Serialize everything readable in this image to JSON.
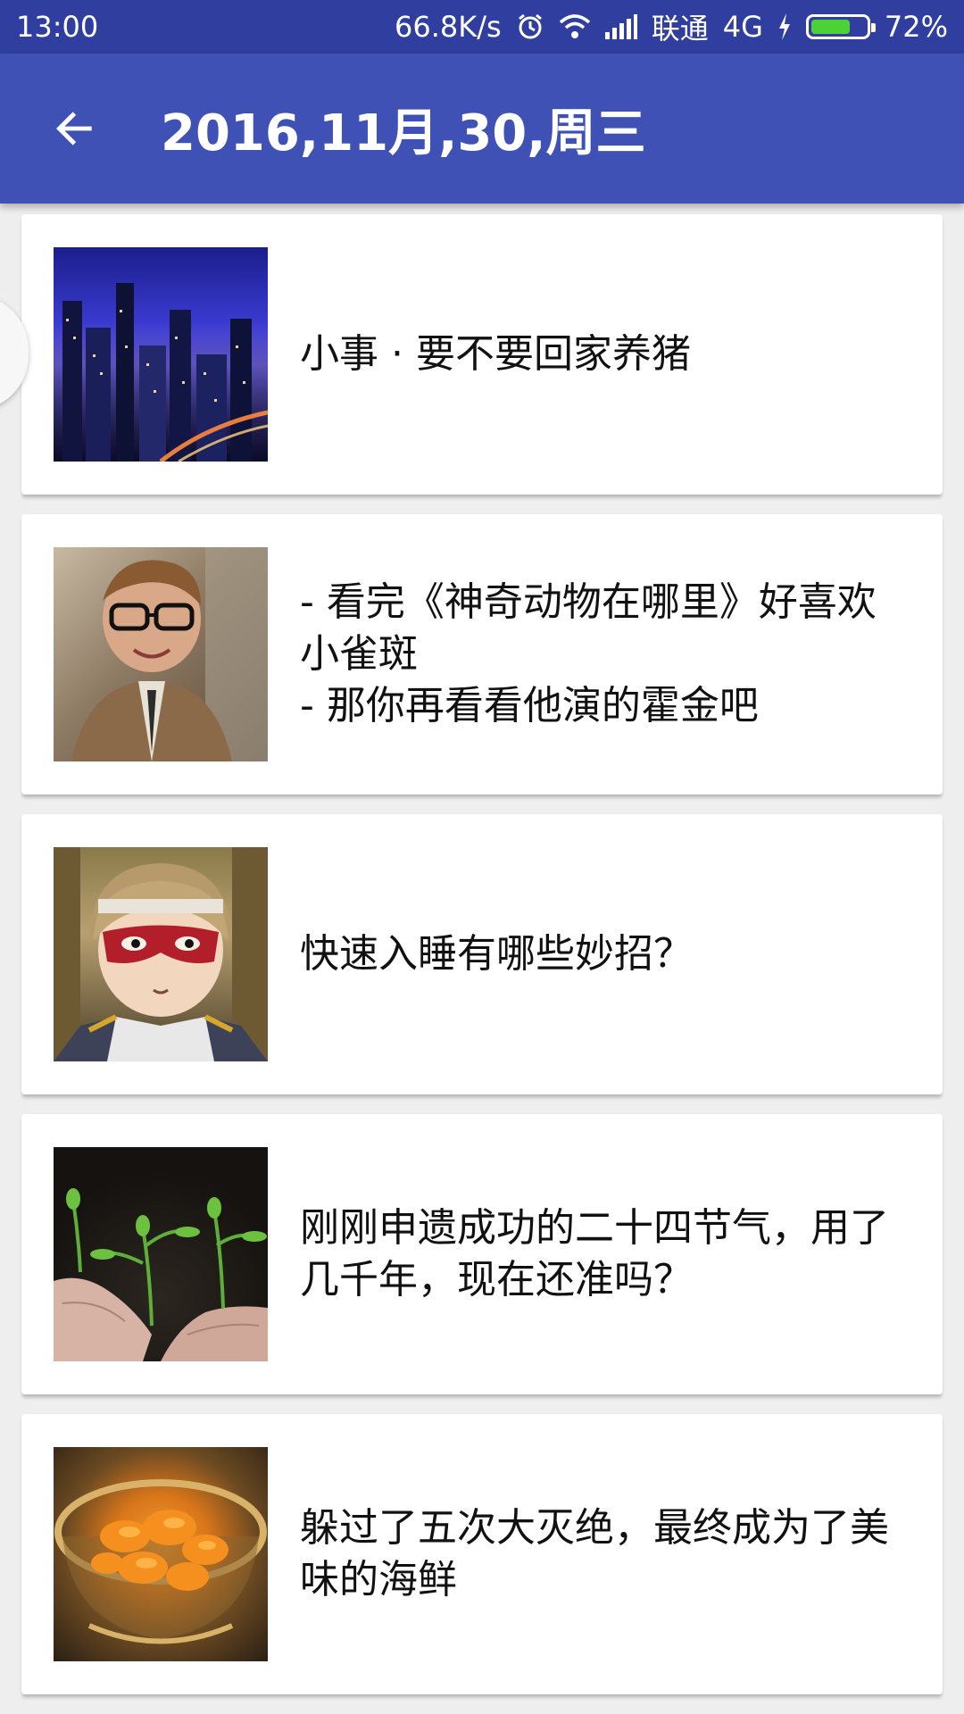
{
  "status_bar": {
    "time": "13:00",
    "speed": "66.8K/s",
    "carrier": "联通",
    "network": "4G",
    "battery": "72%",
    "battery_level": 0.72,
    "icons": [
      "alarm-icon",
      "wifi-icon",
      "signal-icon",
      "charging-icon",
      "battery-icon"
    ]
  },
  "app_bar": {
    "title": "2016,11月,30,周三",
    "back_icon": "arrow-back-icon",
    "color": "#3f51b5",
    "status_color": "#303f9f"
  },
  "stories": [
    {
      "title": "小事 · 要不要回家养猪",
      "image": "city-night-thumbnail"
    },
    {
      "title": "- 看完《神奇动物在哪里》好喜欢小雀斑\n- 那你再看看他演的霍金吧",
      "image": "actor-glasses-thumbnail"
    },
    {
      "title": "快速入睡有哪些妙招？",
      "image": "anime-character-mask-thumbnail"
    },
    {
      "title": "刚刚申遗成功的二十四节气，用了几千年，现在还准吗？",
      "image": "hands-planting-seedlings-thumbnail"
    },
    {
      "title": "躲过了五次大灭绝，最终成为了美味的海鲜",
      "image": "sea-urchin-bowl-thumbnail"
    }
  ]
}
